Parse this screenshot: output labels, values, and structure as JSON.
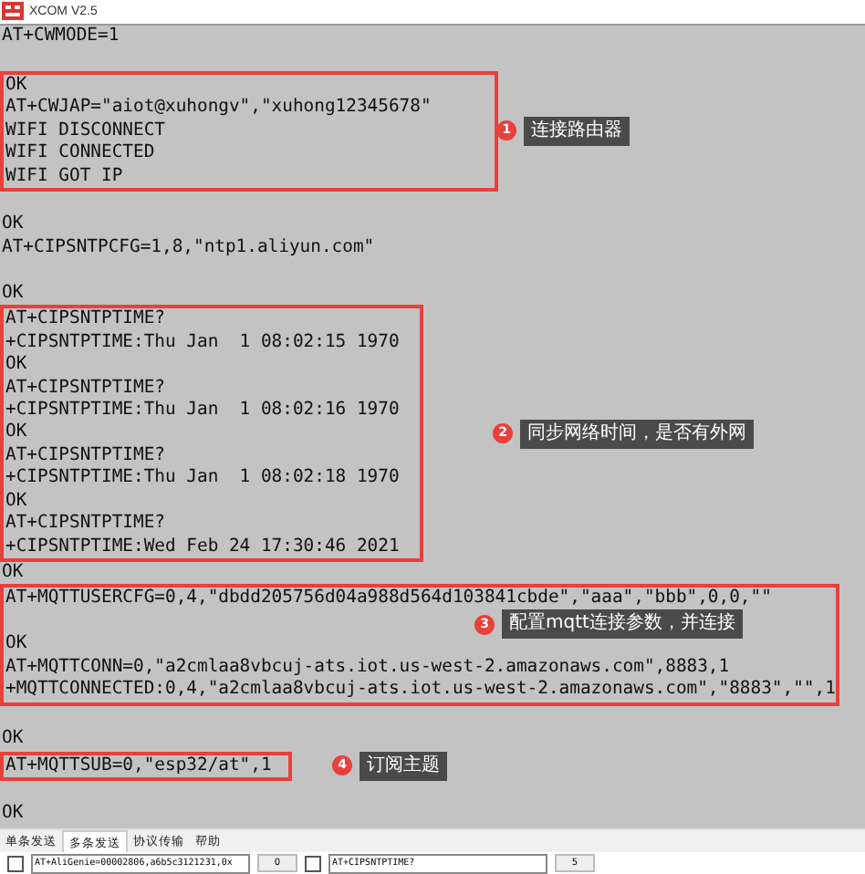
{
  "window": {
    "title": "XCOM V2.5"
  },
  "terminal": [
    {
      "kind": "line",
      "text": "AT+CWMODE=1"
    },
    {
      "kind": "blank"
    },
    {
      "kind": "group",
      "lines": [
        "OK",
        "AT+CWJAP=\"aiot@xuhongv\",\"xuhong12345678\"",
        "WIFI DISCONNECT",
        "WIFI CONNECTED",
        "WIFI GOT IP"
      ],
      "note": {
        "number": "1",
        "text": "连接路由器"
      }
    },
    {
      "kind": "blank"
    },
    {
      "kind": "line",
      "text": "OK"
    },
    {
      "kind": "line",
      "text": "AT+CIPSNTPCFG=1,8,\"ntp1.aliyun.com\""
    },
    {
      "kind": "blank"
    },
    {
      "kind": "line",
      "text": "OK"
    },
    {
      "kind": "group",
      "lines": [
        "AT+CIPSNTPTIME?",
        "+CIPSNTPTIME:Thu Jan  1 08:02:15 1970",
        "OK",
        "AT+CIPSNTPTIME?",
        "+CIPSNTPTIME:Thu Jan  1 08:02:16 1970",
        "OK",
        "AT+CIPSNTPTIME?",
        "+CIPSNTPTIME:Thu Jan  1 08:02:18 1970",
        "OK",
        "AT+CIPSNTPTIME?",
        "+CIPSNTPTIME:Wed Feb 24 17:30:46 2021"
      ],
      "note": {
        "number": "2",
        "text": "同步网络时间，是否有外网"
      }
    },
    {
      "kind": "line",
      "text": "OK"
    },
    {
      "kind": "group",
      "lines": [
        "AT+MQTTUSERCFG=0,4,\"dbdd205756d04a988d564d103841cbde\",\"aaa\",\"bbb\",0,0,\"\"",
        {
          "kind": "blank"
        },
        "OK",
        "AT+MQTTCONN=0,\"a2cmlaa8vbcuj-ats.iot.us-west-2.amazonaws.com\",8883,1",
        "+MQTTCONNECTED:0,4,\"a2cmlaa8vbcuj-ats.iot.us-west-2.amazonaws.com\",\"8883\",\"\",1"
      ],
      "note": {
        "number": "3",
        "text": "配置mqtt连接参数，并连接"
      }
    },
    {
      "kind": "blank"
    },
    {
      "kind": "line",
      "text": "OK"
    },
    {
      "kind": "group",
      "lines": [
        "AT+MQTTSUB=0,\"esp32/at\",1"
      ],
      "note": {
        "number": "4",
        "text": "订阅主题"
      }
    },
    {
      "kind": "blank"
    },
    {
      "kind": "line",
      "text": "OK"
    }
  ],
  "tabs": [
    {
      "label": "单条发送",
      "selected": false
    },
    {
      "label": "多条发送",
      "selected": true
    },
    {
      "label": "协议传输",
      "selected": false
    },
    {
      "label": "帮助",
      "selected": false
    }
  ],
  "send_rows": [
    {
      "checked": false,
      "value": "AT+AliGenie=00002806,a6b5c3121231,0x",
      "button": "0"
    },
    {
      "checked": false,
      "value": "AT+CIPSNTPTIME?",
      "button": "5"
    }
  ]
}
